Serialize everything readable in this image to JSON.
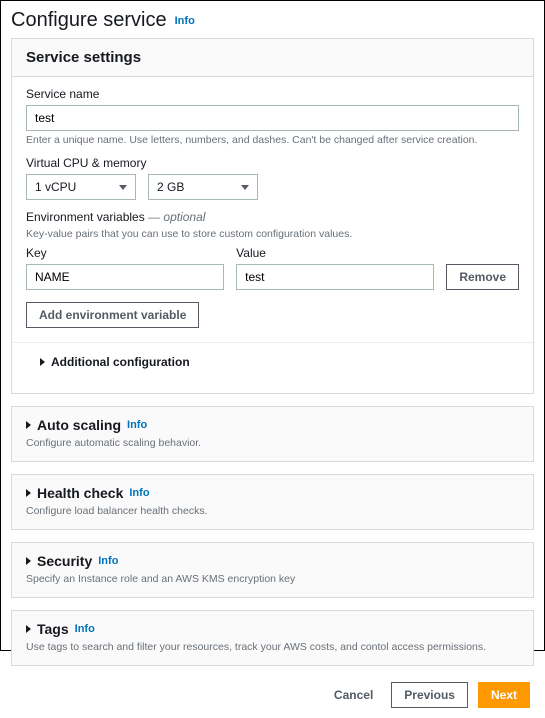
{
  "pageTitle": "Configure service",
  "info": "Info",
  "panelTitle": "Service settings",
  "serviceName": {
    "label": "Service name",
    "value": "test",
    "hint": "Enter a unique name. Use letters, numbers, and dashes. Can't be changed after service creation."
  },
  "compute": {
    "label": "Virtual CPU & memory",
    "vcpu": "1 vCPU",
    "memory": "2 GB"
  },
  "env": {
    "label": "Environment variables",
    "optional": " — optional",
    "hint": "Key-value pairs that you can use to store custom configuration values.",
    "keyLabel": "Key",
    "valueLabel": "Value",
    "key": "NAME",
    "value": "test",
    "removeLabel": "Remove",
    "addLabel": "Add environment variable"
  },
  "additional": "Additional configuration",
  "sections": {
    "autoscaling": {
      "title": "Auto scaling",
      "desc": "Configure automatic scaling behavior."
    },
    "health": {
      "title": "Health check",
      "desc": "Configure load balancer health checks."
    },
    "security": {
      "title": "Security",
      "desc": "Specify an Instance role and an AWS KMS encryption key"
    },
    "tags": {
      "title": "Tags",
      "desc": "Use tags to search and filter your resources, track your AWS costs, and contol access permissions."
    }
  },
  "footer": {
    "cancel": "Cancel",
    "previous": "Previous",
    "next": "Next"
  }
}
